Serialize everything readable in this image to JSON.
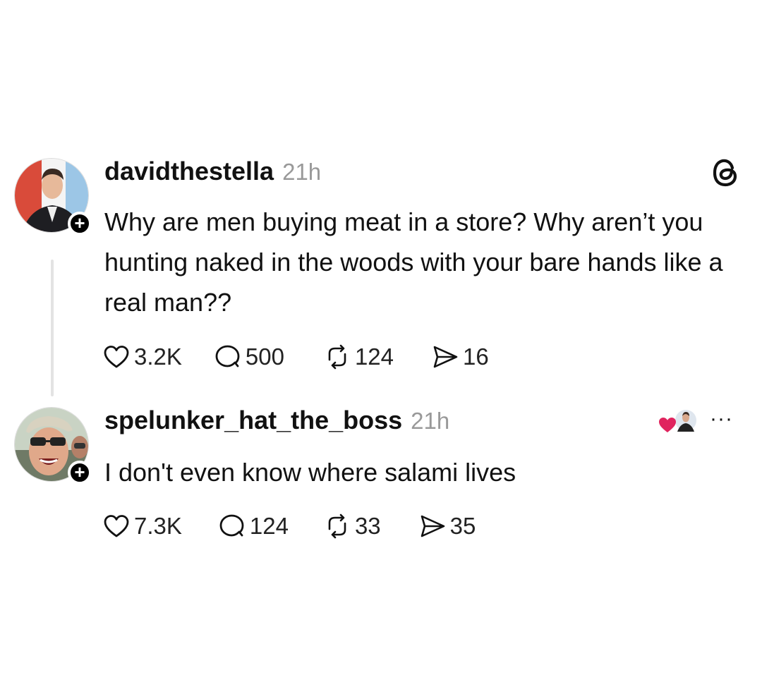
{
  "posts": [
    {
      "username": "davidthestella",
      "time": "21h",
      "text": "Why are men buying meat in a store? Why aren’t you hunting naked in the woods with your bare hands like a real man??",
      "likes": "3.2K",
      "replies": "500",
      "reposts": "124",
      "shares": "16",
      "follow_badge": "+"
    },
    {
      "username": "spelunker_hat_the_boss",
      "time": "21h",
      "text": "I don't even know where salami lives",
      "likes": "7.3K",
      "replies": "124",
      "reposts": "33",
      "shares": "35",
      "follow_badge": "+",
      "more_label": "···"
    }
  ],
  "icons": {
    "platform": "threads-logo-icon",
    "like": "heart-icon",
    "reply": "speech-bubble-icon",
    "repost": "repost-icon",
    "share": "send-icon",
    "more": "more-dots-icon",
    "liked_by_author": "red-heart-with-avatar-icon"
  },
  "colors": {
    "text": "#111111",
    "muted": "#999999",
    "thread_line": "#e3e3e3",
    "liked_heart": "#e0245e",
    "badge": "#000000"
  }
}
